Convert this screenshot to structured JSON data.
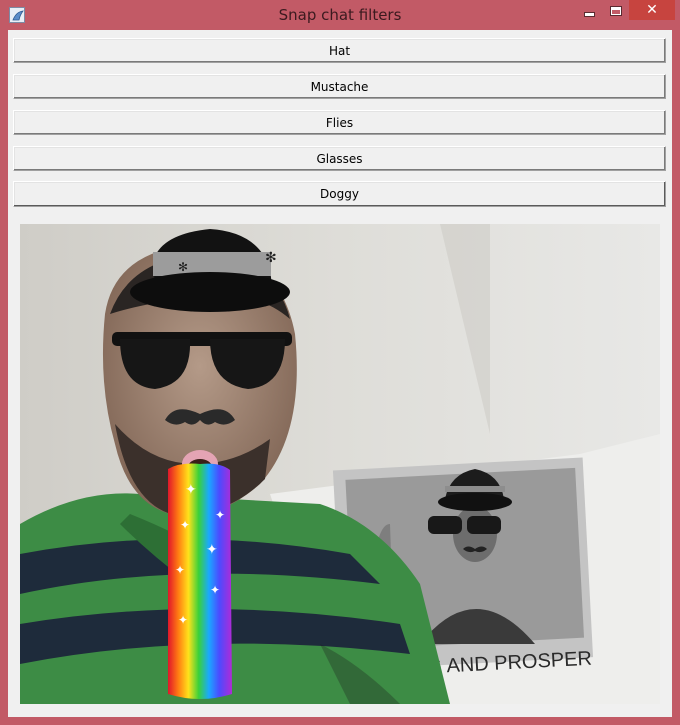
{
  "window": {
    "title": "Snap chat filters",
    "controls": {
      "minimize": "minimize",
      "maximize": "maximize",
      "close": "close"
    }
  },
  "filters": {
    "buttons": [
      {
        "label": "Hat"
      },
      {
        "label": "Mustache"
      },
      {
        "label": "Flies"
      },
      {
        "label": "Glasses"
      },
      {
        "label": "Doggy"
      }
    ]
  },
  "camera_view": {
    "shirt_text": "NG AND PROSPER"
  },
  "colors": {
    "titlebar": "#c25a66",
    "close_button": "#c7443f",
    "client_background": "#f0f0f0"
  }
}
